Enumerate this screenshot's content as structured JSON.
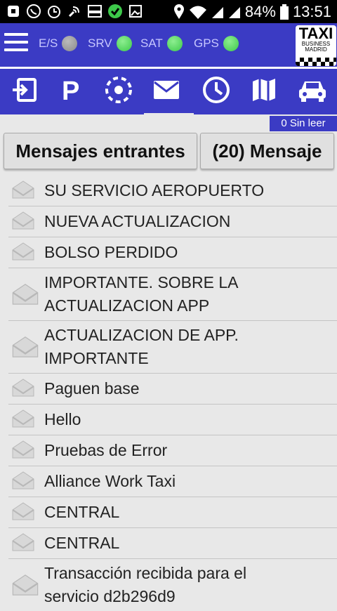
{
  "status_bar": {
    "battery": "84%",
    "time": "13:51",
    "notification_icons": [
      "square-icon",
      "whatsapp-icon",
      "alarm-icon",
      "phone-wave-icon",
      "taxi-icon",
      "check-circle-icon",
      "image-icon"
    ],
    "system_icons": [
      "location-icon",
      "wifi-icon",
      "signal-icon",
      "signal-icon",
      "battery-icon"
    ]
  },
  "header": {
    "indicators": [
      {
        "label": "E/S",
        "status_color": "#8a8a8a"
      },
      {
        "label": "SRV",
        "status_color": "#3dc94a"
      },
      {
        "label": "SAT",
        "status_color": "#3dc94a"
      },
      {
        "label": "GPS",
        "status_color": "#3dc94a"
      }
    ],
    "logo": {
      "title": "TAXI",
      "line1": "BUSINESS",
      "line2": "MADRID"
    }
  },
  "nav_icons": [
    "login-icon",
    "parking-icon",
    "target-icon",
    "mail-icon",
    "clock-icon",
    "map-icon",
    "taxi-car-icon"
  ],
  "unread_label": "0 Sin leer",
  "tabs": {
    "incoming": "Mensajes entrantes",
    "new": "(20) Mensaje"
  },
  "messages": [
    {
      "text": "SU SERVICIO AEROPUERTO"
    },
    {
      "text": "NUEVA ACTUALIZACION"
    },
    {
      "text": "BOLSO PERDIDO"
    },
    {
      "text": "IMPORTANTE. SOBRE LA ACTUALIZACION APP"
    },
    {
      "text": "ACTUALIZACION DE APP. IMPORTANTE"
    },
    {
      "text": "Paguen base"
    },
    {
      "text": "Hello"
    },
    {
      "text": "Pruebas de Error"
    },
    {
      "text": "Alliance Work Taxi"
    },
    {
      "text": "CENTRAL"
    },
    {
      "text": "CENTRAL"
    },
    {
      "text": "Transacción recibida para el servicio d2b296d9"
    }
  ],
  "colors": {
    "primary": "#3b3bc4",
    "background": "#e8e8e8",
    "active": "#3dc94a",
    "inactive": "#8a8a8a"
  }
}
